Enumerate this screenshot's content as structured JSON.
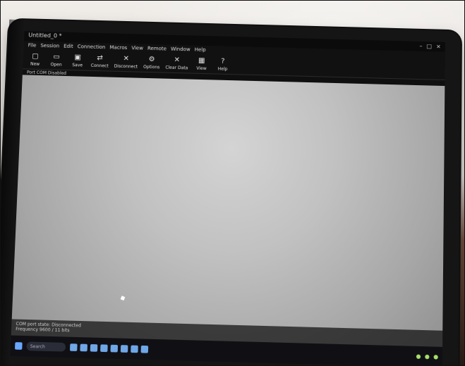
{
  "photo": {
    "app": {
      "window_title": "Untitled_0 *",
      "menu": [
        "File",
        "Session",
        "Edit",
        "Connection",
        "Macros",
        "View",
        "Remote",
        "Window",
        "Help"
      ],
      "toolbar": [
        {
          "label": "New",
          "icon": "new-icon"
        },
        {
          "label": "Open",
          "icon": "open-icon"
        },
        {
          "label": "Save",
          "icon": "save-icon"
        },
        {
          "label": "Connect",
          "icon": "connect-icon"
        },
        {
          "label": "Disconnect",
          "icon": "disconnect-icon"
        },
        {
          "label": "Options",
          "icon": "options-icon"
        },
        {
          "label": "Clear Data",
          "icon": "clear-icon"
        },
        {
          "label": "View",
          "icon": "view-icon"
        },
        {
          "label": "Help",
          "icon": "help-icon"
        }
      ],
      "status_strip_text": "Port COM Disabled",
      "console_lines": [
        "COM port state: Disconnected",
        "Frequency 9600 / 11 bits"
      ]
    },
    "taskbar": {
      "search_placeholder": "Search"
    },
    "colors": {
      "screen_bg": "#c8c8c8",
      "app_dark": "#111111",
      "taskbar": "#101014",
      "accent_blue": "#6aa7ff",
      "tray_green": "#a6e06d"
    }
  }
}
